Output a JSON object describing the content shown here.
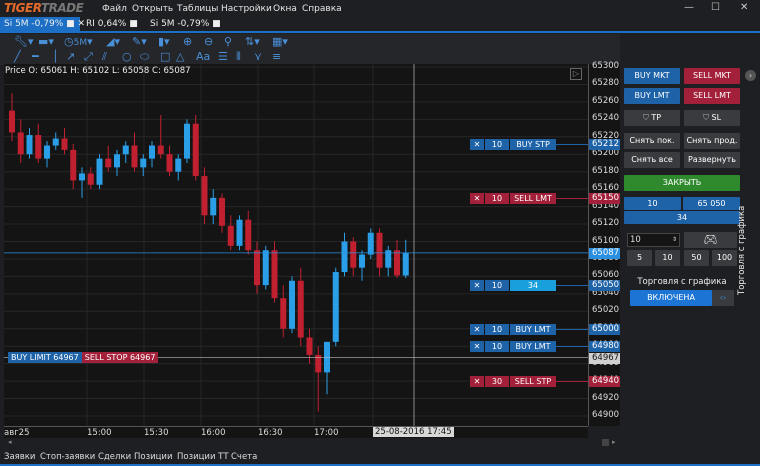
{
  "app": {
    "logo": "TIGERTRADE",
    "menu": [
      "Файл",
      "Открыть",
      "Таблицы",
      "Настройки",
      "Окна",
      "Справка"
    ]
  },
  "tabs": [
    {
      "label": "Si 5M -0,79%",
      "active": true
    },
    {
      "label": "RI 0,64%"
    },
    {
      "label": "Si 5M -0,79%"
    }
  ],
  "toolbar": {
    "timeframe": "5M",
    "font_label": "Aa"
  },
  "ohlc_text": "Price O: 65061 H: 65102 L: 65058 C: 65087",
  "price_scale": {
    "labels": [
      65300,
      65280,
      65260,
      65240,
      65220,
      65200,
      65180,
      65160,
      65140,
      65120,
      65100,
      65080,
      65060,
      65040,
      65020,
      65000,
      64980,
      64960,
      64940,
      64920,
      64900
    ],
    "min": 64900,
    "max": 65300
  },
  "price_tags": [
    {
      "price": "65212",
      "color": "#1e62a8"
    },
    {
      "price": "65150",
      "color": "#a3203a"
    },
    {
      "price": "65087",
      "color": "#2a8fe0"
    },
    {
      "price": "65050",
      "color": "#1e62a8"
    },
    {
      "price": "65000",
      "color": "#1e62a8"
    },
    {
      "price": "64980",
      "color": "#1e62a8"
    },
    {
      "price": "64967",
      "color": "#d0d0d0"
    },
    {
      "price": "64940",
      "color": "#a3203a"
    }
  ],
  "orders": [
    {
      "price": 65212,
      "qty": "10",
      "label": "BUY STP",
      "side": "buy"
    },
    {
      "price": 65150,
      "qty": "10",
      "label": "SELL LMT",
      "side": "sell"
    },
    {
      "price": 65050,
      "qty": "10",
      "label": "34",
      "side": "pos"
    },
    {
      "price": 65000,
      "qty": "10",
      "label": "BUY LMT",
      "side": "buy"
    },
    {
      "price": 64980,
      "qty": "10",
      "label": "BUY LMT",
      "side": "buy"
    },
    {
      "price": 64940,
      "qty": "30",
      "label": "SELL STP",
      "side": "sell"
    }
  ],
  "cursor_line": {
    "buy_label": "BUY LIMIT 64967",
    "sell_label": "SELL STOP 64967",
    "price": 64967
  },
  "time_axis": {
    "labels": [
      "авг25",
      "15:00",
      "15:30",
      "16:00",
      "16:30",
      "17:00"
    ],
    "cursor": "25-08-2016 17:45"
  },
  "candles": [
    [
      65250,
      65270,
      65215,
      65225
    ],
    [
      65225,
      65240,
      65190,
      65200
    ],
    [
      65200,
      65230,
      65195,
      65222
    ],
    [
      65222,
      65235,
      65190,
      65195
    ],
    [
      65195,
      65215,
      65185,
      65210
    ],
    [
      65210,
      65225,
      65205,
      65218
    ],
    [
      65218,
      65230,
      65200,
      65205
    ],
    [
      65205,
      65212,
      65160,
      65170
    ],
    [
      65170,
      65185,
      65150,
      65178
    ],
    [
      65178,
      65185,
      65160,
      65165
    ],
    [
      65165,
      65200,
      65160,
      65195
    ],
    [
      65195,
      65210,
      65180,
      65185
    ],
    [
      65185,
      65205,
      65175,
      65200
    ],
    [
      65200,
      65215,
      65190,
      65210
    ],
    [
      65210,
      65225,
      65180,
      65185
    ],
    [
      65185,
      65200,
      65175,
      65195
    ],
    [
      65195,
      65215,
      65185,
      65210
    ],
    [
      65210,
      65245,
      65195,
      65200
    ],
    [
      65200,
      65210,
      65175,
      65180
    ],
    [
      65180,
      65200,
      65170,
      65195
    ],
    [
      65195,
      65240,
      65190,
      65235
    ],
    [
      65235,
      65245,
      65170,
      65175
    ],
    [
      65175,
      65185,
      65120,
      65130
    ],
    [
      65130,
      65160,
      65120,
      65150
    ],
    [
      65150,
      65155,
      65110,
      65118
    ],
    [
      65118,
      65130,
      65090,
      65095
    ],
    [
      65095,
      65130,
      65090,
      65125
    ],
    [
      65125,
      65135,
      65085,
      65090
    ],
    [
      65090,
      65100,
      65040,
      65050
    ],
    [
      65050,
      65095,
      65045,
      65090
    ],
    [
      65090,
      65100,
      65030,
      65035
    ],
    [
      65035,
      65050,
      64990,
      65000
    ],
    [
      65000,
      65060,
      64995,
      65055
    ],
    [
      65055,
      65070,
      64980,
      64990
    ],
    [
      64990,
      65000,
      64960,
      64970
    ],
    [
      64970,
      64980,
      64905,
      64950
    ],
    [
      64950,
      64985,
      64925,
      64985
    ],
    [
      64985,
      65070,
      64980,
      65065
    ],
    [
      65065,
      65110,
      65060,
      65100
    ],
    [
      65100,
      65105,
      65060,
      65070
    ],
    [
      65070,
      65090,
      65055,
      65085
    ],
    [
      65085,
      65115,
      65080,
      65110
    ],
    [
      65110,
      65115,
      65060,
      65070
    ],
    [
      65070,
      65095,
      65060,
      65090
    ],
    [
      65090,
      65102,
      65058,
      65061
    ],
    [
      65061,
      65102,
      65058,
      65087
    ]
  ],
  "panel": {
    "buy_mkt": "BUY MKT",
    "sell_mkt": "SELL MKT",
    "buy_lmt": "BUY LMT",
    "sell_lmt": "SELL LMT",
    "tp": "TP",
    "sl": "SL",
    "cancel_buy": "Снять пок.",
    "cancel_sell": "Снять прод.",
    "cancel_all": "Снять все",
    "reverse": "Развернуть",
    "close": "ЗАКРЫТЬ",
    "pos_qty": "10",
    "pos_price": "65 050",
    "pos_pnl": "34",
    "qty_value": "10",
    "presets": [
      "5",
      "10",
      "50",
      "100"
    ],
    "chart_trading_label": "Торговля с графика",
    "chart_trading_state": "ВКЛЮЧЕНА",
    "vertical_title": "Торговля с графика"
  },
  "bottom_tabs": [
    "Заявки",
    "Стоп-заявки",
    "Сделки",
    "Позиции",
    "Позиции ТТ",
    "Счета"
  ],
  "colors": {
    "accent": "#1c6fc4",
    "buy": "#1e62a8",
    "sell": "#a3203a",
    "up": "#2a9fe8",
    "down": "#c0202f"
  }
}
